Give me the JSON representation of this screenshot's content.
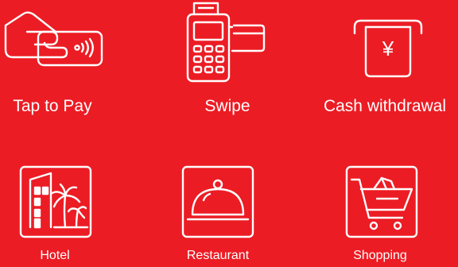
{
  "colors": {
    "background": "#ec1c24",
    "foreground": "#ffffff"
  },
  "payment_methods": [
    {
      "label": "Tap to Pay",
      "icon": "contactless-card-icon"
    },
    {
      "label": "Swipe",
      "icon": "card-terminal-icon"
    },
    {
      "label": "Cash withdrawal",
      "icon": "yuan-withdrawal-icon"
    }
  ],
  "merchant_categories": [
    {
      "label": "Hotel",
      "icon": "hotel-icon"
    },
    {
      "label": "Restaurant",
      "icon": "restaurant-cloche-icon"
    },
    {
      "label": "Shopping",
      "icon": "shopping-cart-icon"
    }
  ],
  "yuan_symbol": "¥"
}
